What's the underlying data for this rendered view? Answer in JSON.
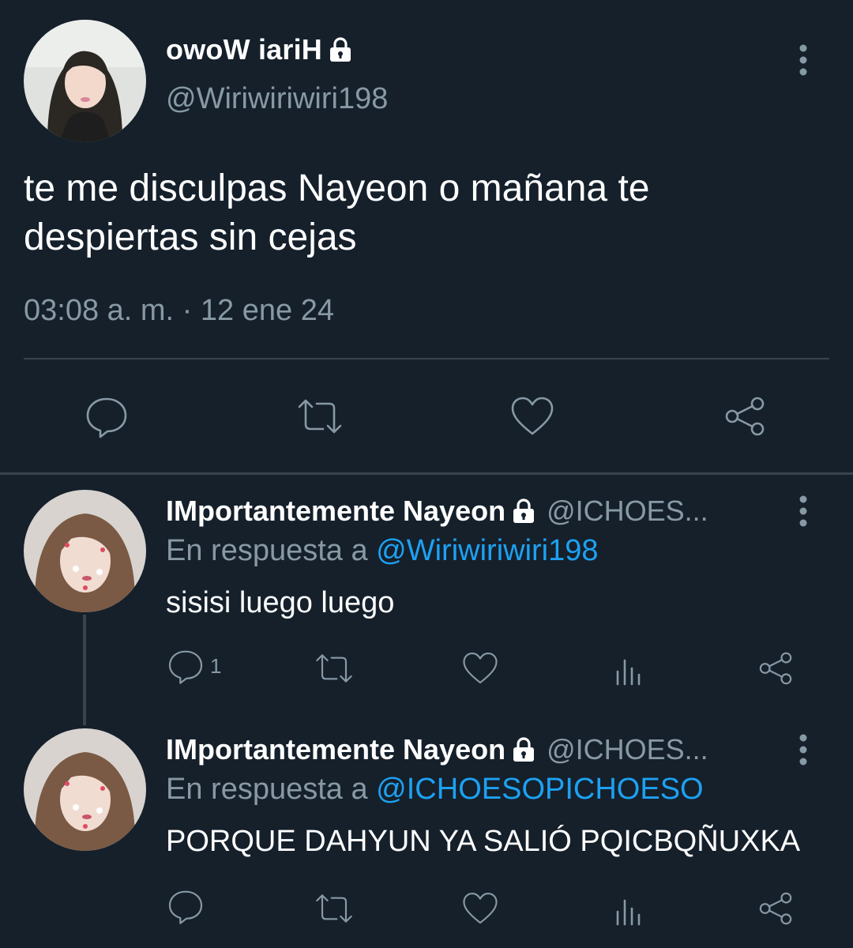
{
  "main_tweet": {
    "display_name": "owoW iariH",
    "handle": "@Wiriwiriwiri198",
    "text": "te me disculpas Nayeon o mañana te despiertas sin cejas",
    "time": "03:08 a. m.",
    "separator": " · ",
    "date": "12 ene 24",
    "icons": [
      "lock-icon",
      "more-icon",
      "reply-icon",
      "retweet-icon",
      "like-icon",
      "share-icon"
    ]
  },
  "replies": [
    {
      "display_name": "IMportantemente Nayeon",
      "handle": "@ICHOES...",
      "reply_prefix": "En respuesta a ",
      "reply_to": "@Wiriwiriwiri198",
      "text": "sisisi luego luego",
      "reply_count": "1"
    },
    {
      "display_name": "IMportantemente Nayeon",
      "handle": "@ICHOES...",
      "reply_prefix": "En respuesta a ",
      "reply_to": "@ICHOESOPICHOESO",
      "text": "PORQUE DAHYUN YA SALIÓ PQICBQÑUXKA",
      "reply_count": ""
    }
  ],
  "colors": {
    "background": "#15202b",
    "secondary_text": "#8899a6",
    "link": "#1da1f2",
    "divider": "#38444d"
  }
}
